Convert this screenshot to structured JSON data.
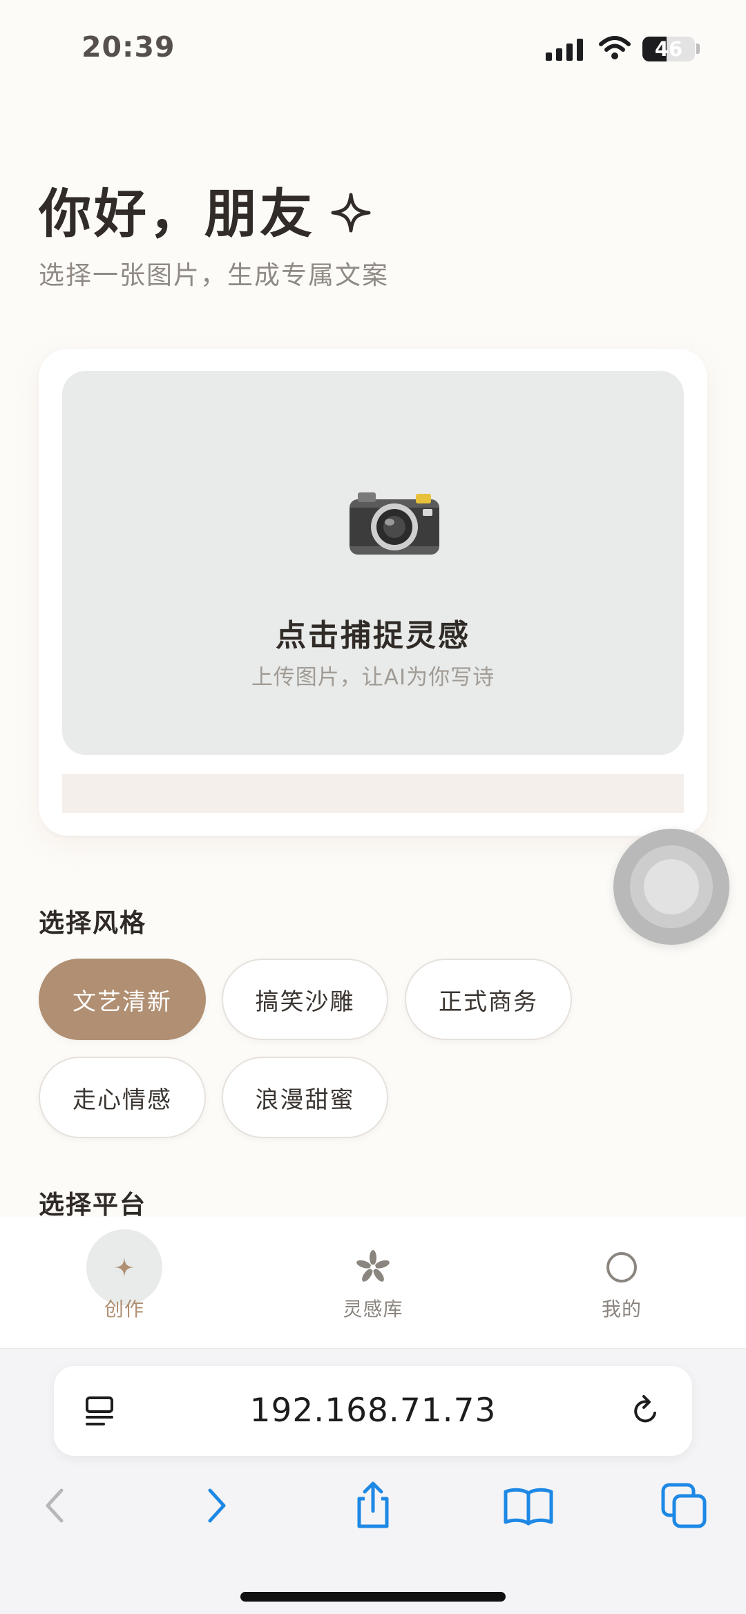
{
  "status_bar": {
    "time": "20:39",
    "battery_level": "46",
    "battery_fraction": 0.46
  },
  "header": {
    "greeting": "你好，朋友",
    "subtitle": "选择一张图片，生成专属文案",
    "sparkle_icon": "sparkle-icon"
  },
  "upload": {
    "icon": "camera-icon",
    "title": "点击捕捉灵感",
    "hint": "上传图片，让AI为你写诗"
  },
  "style_section": {
    "label": "选择风格",
    "options": [
      {
        "label": "文艺清新",
        "selected": true
      },
      {
        "label": "搞笑沙雕",
        "selected": false
      },
      {
        "label": "正式商务",
        "selected": false
      },
      {
        "label": "走心情感",
        "selected": false
      },
      {
        "label": "浪漫甜蜜",
        "selected": false
      }
    ]
  },
  "platform_section": {
    "label": "选择平台"
  },
  "tab_bar": {
    "items": [
      {
        "label": "创作",
        "icon": "sparkle-icon",
        "active": true
      },
      {
        "label": "灵感库",
        "icon": "flower-icon",
        "active": false
      },
      {
        "label": "我的",
        "icon": "circle-icon",
        "active": false
      }
    ]
  },
  "browser": {
    "url": "192.168.71.73"
  },
  "colors": {
    "accent": "#b08f72",
    "background": "#fcfbf8",
    "drop_zone": "#e8ebe9",
    "text_primary": "#2f2a26",
    "text_secondary": "#908a84",
    "browser_blue": "#1e88e5"
  }
}
